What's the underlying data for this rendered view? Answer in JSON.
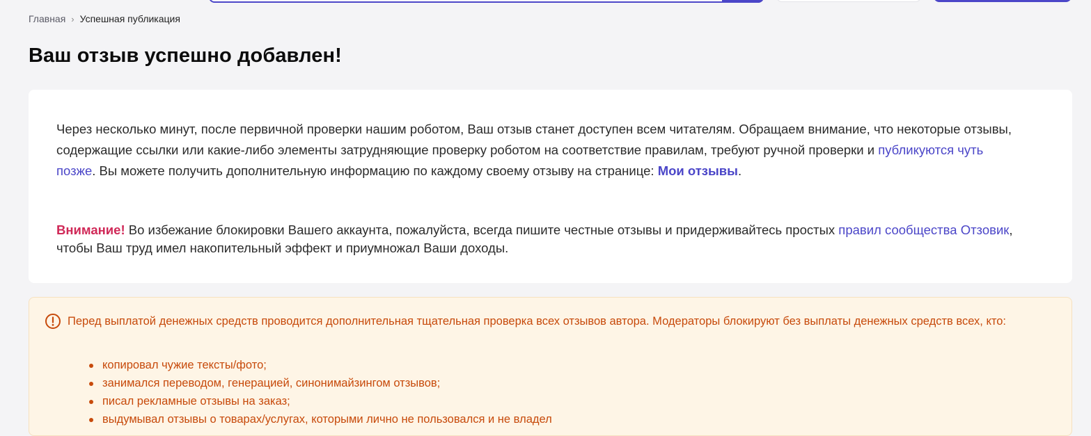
{
  "breadcrumb": {
    "home": "Главная",
    "separator": "›",
    "current": "Успешная публикация"
  },
  "page_title": "Ваш отзыв успешно добавлен!",
  "card": {
    "p1_part1": "Через несколько минут, после первичной проверки нашим роботом, Ваш отзыв станет доступен всем читателям. Обращаем внимание, что некоторые отзывы, содержащие ссылки или какие-либо элементы затрудняющие проверку роботом на соответствие правилам, требуют ручной проверки и ",
    "p1_link": "публикуются чуть позже",
    "p1_part2": ". Вы можете получить дополнительную информацию по каждому своему отзыву на странице: ",
    "my_reviews_link": "Мои отзывы",
    "p1_end": ".",
    "attention": "Внимание!",
    "p2_part1": " Во избежание блокировки Вашего аккаунта, пожалуйста, всегда пишите честные отзывы и придерживайтесь простых ",
    "rules_link": "правил сообщества Отзовик",
    "p2_part2": ", чтобы Ваш труд имел накопительный эффект и приумножал Ваши доходы."
  },
  "warning": {
    "icon": "exclamation-circle-icon",
    "text": "Перед выплатой денежных средств проводится дополнительная тщательная проверка всех отзывов автора. Модераторы блокируют без выплаты денежных средств всех, кто:",
    "items": [
      "копировал чужие тексты/фото;",
      "занимался переводом, генерацией, синонимайзингом отзывов;",
      "писал рекламные отзывы на заказ;",
      "выдумывал отзывы о товарах/услугах, которыми лично не пользовался и не владел"
    ]
  },
  "colors": {
    "accent": "#4b46c8",
    "attention": "#d02958",
    "warning_text": "#c74a0b",
    "warning_bg": "#fef5e6"
  }
}
